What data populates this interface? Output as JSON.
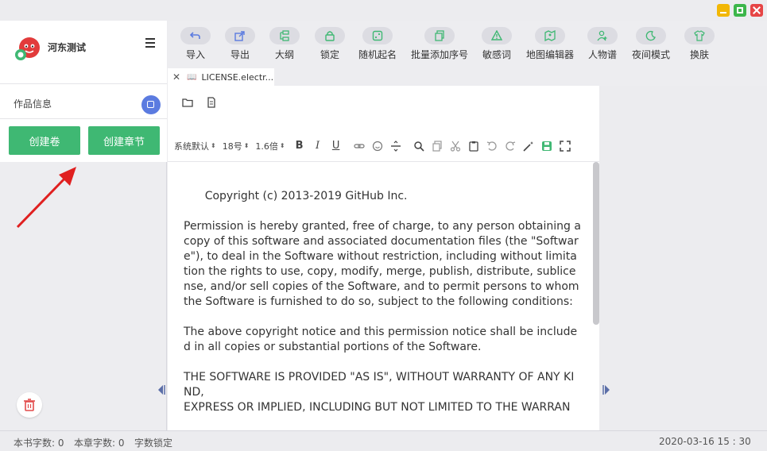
{
  "app": {
    "name": "河东测试"
  },
  "sidebar": {
    "work_info_label": "作品信息",
    "create_volume_label": "创建卷",
    "create_chapter_label": "创建章节"
  },
  "toolbar": {
    "items": [
      {
        "label": "导入",
        "icon": "import-icon"
      },
      {
        "label": "导出",
        "icon": "export-icon"
      },
      {
        "label": "大纲",
        "icon": "outline-icon"
      },
      {
        "label": "锁定",
        "icon": "lock-icon"
      },
      {
        "label": "随机起名",
        "icon": "dice-icon"
      },
      {
        "label": "批量添加序号",
        "icon": "copy-icon"
      },
      {
        "label": "敏感词",
        "icon": "warning-icon"
      },
      {
        "label": "地图编辑器",
        "icon": "map-icon"
      },
      {
        "label": "人物谱",
        "icon": "person-add-icon"
      },
      {
        "label": "夜间模式",
        "icon": "moon-icon"
      },
      {
        "label": "换肤",
        "icon": "shirt-icon"
      }
    ]
  },
  "tab": {
    "title": "LICENSE.electr..."
  },
  "format_bar": {
    "font": "系统默认",
    "size": "18号",
    "line_height": "1.6倍"
  },
  "document": {
    "text": "      Copyright (c) 2013-2019 GitHub Inc.\n\nPermission is hereby granted, free of charge, to any person obtaining a copy of this software and associated documentation files (the \"Software\"), to deal in the Software without restriction, including without limitation the rights to use, copy, modify, merge, publish, distribute, sublicense, and/or sell copies of the Software, and to permit persons to whom the Software is furnished to do so, subject to the following conditions:\n\nThe above copyright notice and this permission notice shall be included in all copies or substantial portions of the Software.\n\nTHE SOFTWARE IS PROVIDED \"AS IS\", WITHOUT WARRANTY OF ANY KIND,\nEXPRESS OR IMPLIED, INCLUDING BUT NOT LIMITED TO THE WARRAN"
  },
  "status": {
    "book_count": "本书字数: 0",
    "chapter_count": "本章字数: 0",
    "lock_label": "字数锁定",
    "datetime": "2020-03-16 15 : 30"
  },
  "colors": {
    "accent_green": "#3fb873",
    "edit_blue": "#5b7be0"
  }
}
